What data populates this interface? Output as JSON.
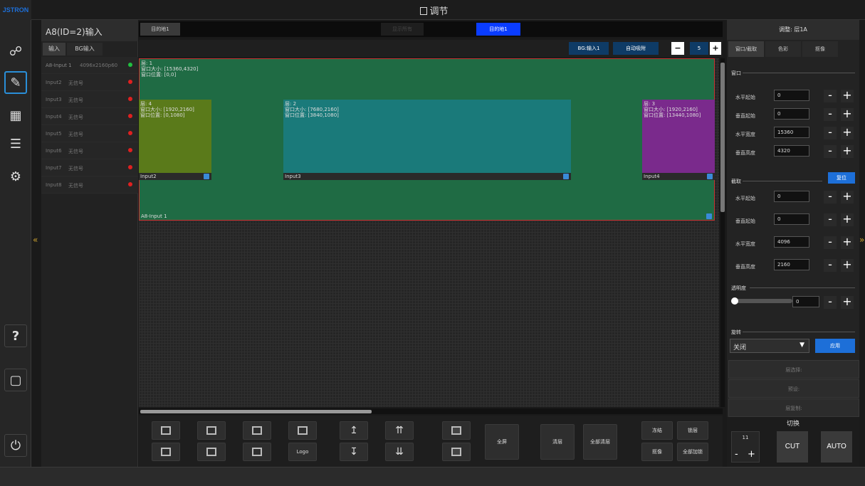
{
  "app": {
    "logo": "JSTRON",
    "title": "调节"
  },
  "colors": {
    "accent": "#1d6fd8",
    "active_dest": "#0a3cff",
    "layer1": "#1f6b44",
    "layer2": "#1a7a7a",
    "layer3": "#7a2a8c",
    "layer4": "#5a7a1a"
  },
  "iconbar": {
    "items": [
      "link-icon",
      "edit-icon",
      "grid-icon",
      "list-icon",
      "gear-icon",
      "help-icon",
      "save-icon",
      "power-icon"
    ]
  },
  "left_panel": {
    "title": "A8(ID=2)输入",
    "tabs": [
      "输入",
      "BG输入"
    ],
    "inputs": [
      {
        "name": "A8-Input 1",
        "signal": "4096x2160p60",
        "status": "ok"
      },
      {
        "name": "Input2",
        "signal": "无信号",
        "status": "none"
      },
      {
        "name": "Input3",
        "signal": "无信号",
        "status": "none"
      },
      {
        "name": "Input4",
        "signal": "无信号",
        "status": "none"
      },
      {
        "name": "Input5",
        "signal": "无信号",
        "status": "none"
      },
      {
        "name": "Input6",
        "signal": "无信号",
        "status": "none"
      },
      {
        "name": "Input7",
        "signal": "无信号",
        "status": "none"
      },
      {
        "name": "Input8",
        "signal": "无信号",
        "status": "none"
      }
    ]
  },
  "dest_bar": {
    "left_tab": "目的地1",
    "middle": "显示所有",
    "right_tab": "目的地1"
  },
  "ctrl_bar": {
    "bg": "BG:输入1",
    "auto": "自动吸附",
    "count": "5",
    "minus": "−",
    "plus": "+"
  },
  "canvas": {
    "layers": [
      {
        "title": "层: 1",
        "size": "窗口大小: [15360,4320]",
        "pos": "窗口位置: [0,0]",
        "input": "A8-Input 1"
      },
      {
        "title": "层: 4",
        "size": "窗口大小: [1920,2160]",
        "pos": "窗口位置: [0,1080]",
        "input": "Input2"
      },
      {
        "title": "层: 2",
        "size": "窗口大小: [7680,2160]",
        "pos": "窗口位置: [3840,1080]",
        "input": "Input3"
      },
      {
        "title": "层: 3",
        "size": "窗口大小: [1920,2160]",
        "pos": "窗口位置: [13440,1080]",
        "input": "Input4"
      }
    ]
  },
  "bottom": {
    "logo": "Logo",
    "fullscreen": "全屏",
    "clear": "清层",
    "clear_all": "全部清层",
    "freeze": "冻结",
    "lock": "锁层",
    "mirror": "抠像",
    "lock_all": "全部加锁"
  },
  "right_panel": {
    "title": "调整: 层1A",
    "tabs": [
      "窗口/截取",
      "色彩",
      "抠像"
    ],
    "window_section": "窗口",
    "window_fields": [
      {
        "label": "水平起始",
        "value": "0"
      },
      {
        "label": "垂直起始",
        "value": "0"
      },
      {
        "label": "水平宽度",
        "value": "15360"
      },
      {
        "label": "垂直高度",
        "value": "4320"
      }
    ],
    "crop_section": "截取",
    "reset": "复位",
    "crop_fields": [
      {
        "label": "水平起始",
        "value": "0"
      },
      {
        "label": "垂直起始",
        "value": "0"
      },
      {
        "label": "水平宽度",
        "value": "4096"
      },
      {
        "label": "垂直高度",
        "value": "2160"
      }
    ],
    "opacity_section": "透明度",
    "opacity_value": "0",
    "rotate_section": "旋转",
    "rotate_value": "关闭",
    "apply": "应用",
    "layer_select": "层选择:",
    "preset": "预设:",
    "layer_copy": "层复制:",
    "switch_title": "切换",
    "switch_value": "11",
    "cut": "CUT",
    "auto": "AUTO"
  }
}
